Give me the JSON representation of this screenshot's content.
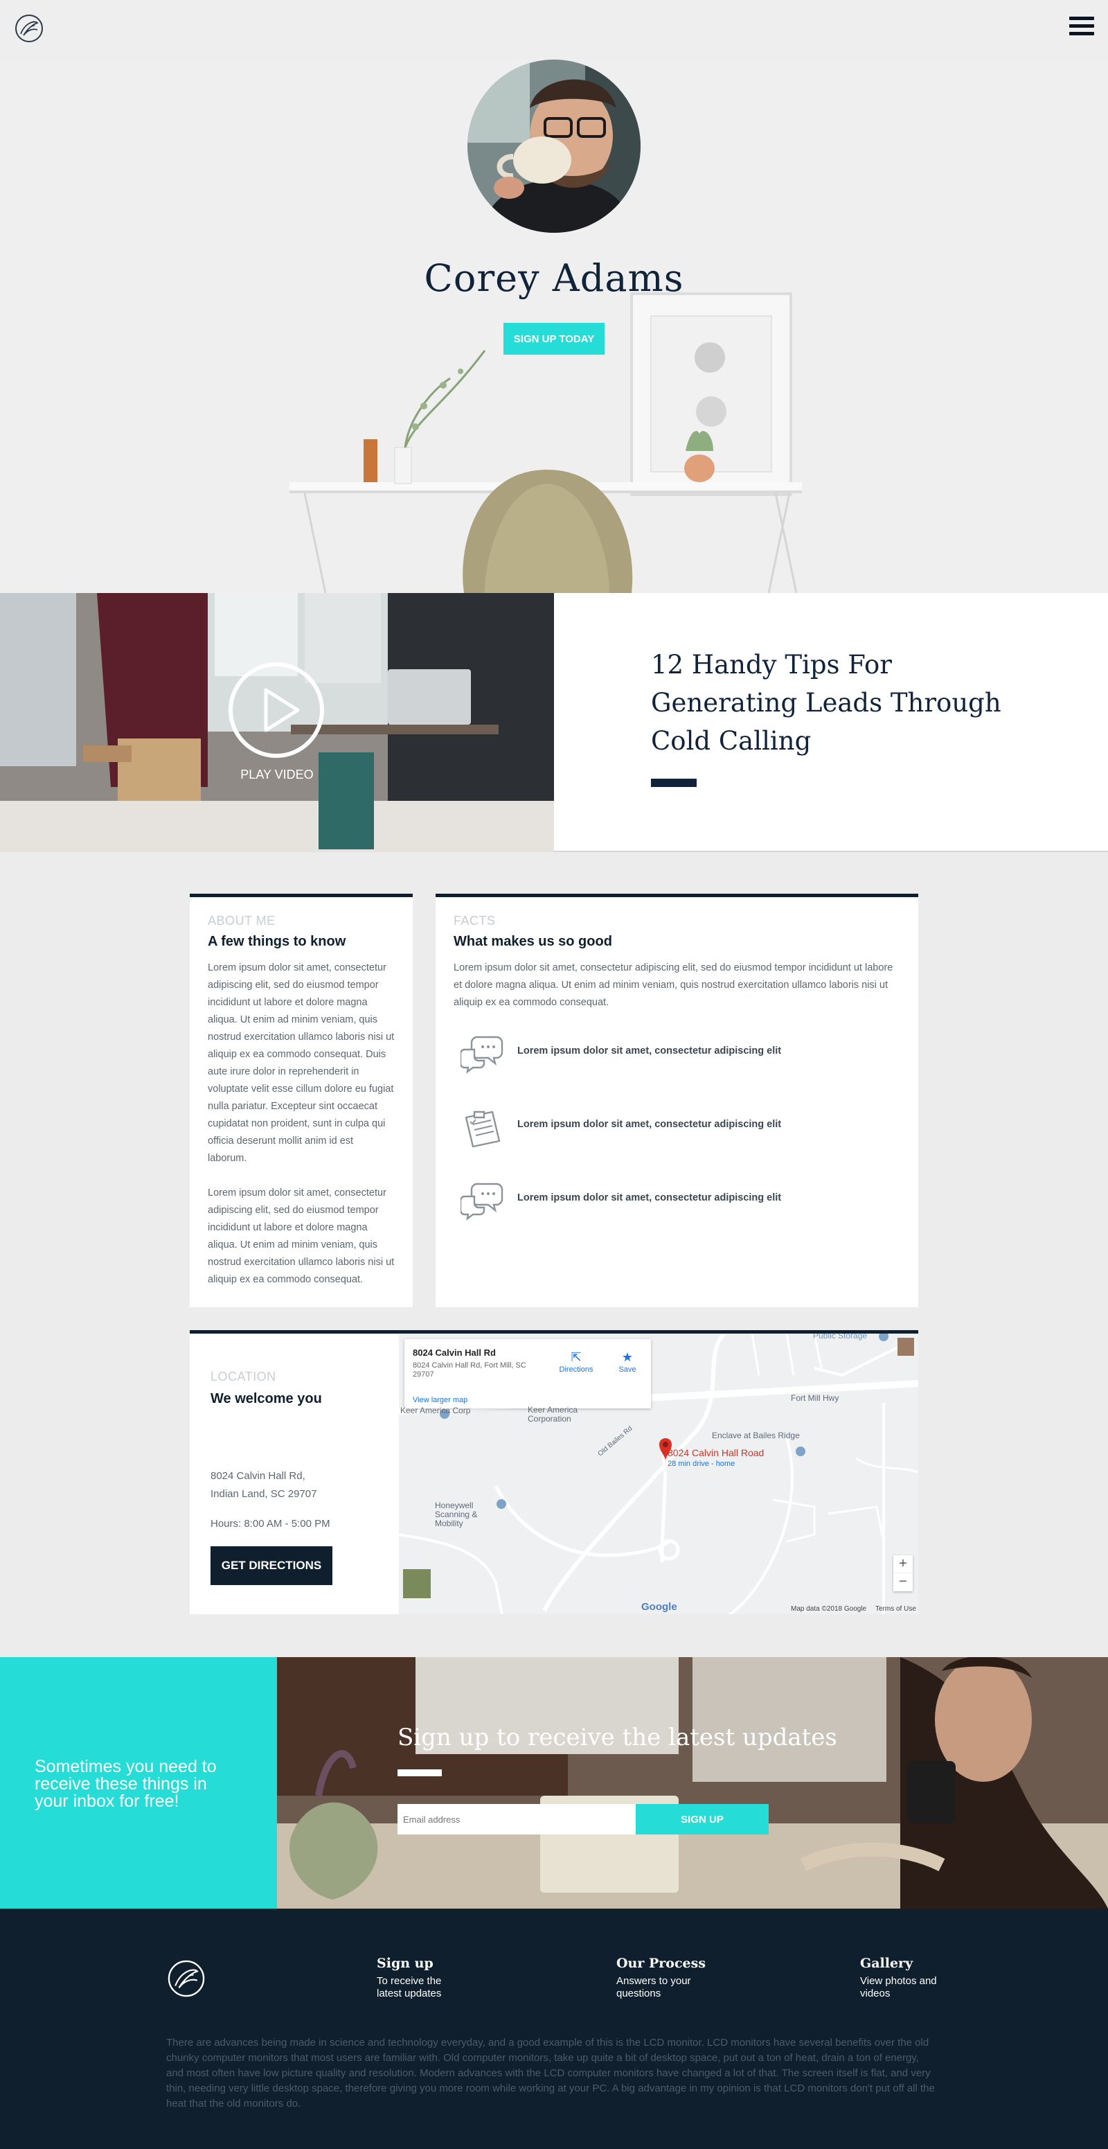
{
  "header": {
    "logo_icon": "leaf-circle-logo",
    "menu_icon": "hamburger-menu-icon"
  },
  "hero": {
    "name": "Corey Adams",
    "cta_label": "SIGN UP TODAY"
  },
  "video": {
    "play_label": "PLAY VIDEO"
  },
  "article": {
    "title": "12 Handy Tips For Generating Leads Through Cold Calling"
  },
  "about": {
    "eyebrow": "ABOUT ME",
    "heading": "A few things to know",
    "paragraph_1": "Lorem ipsum dolor sit amet, consectetur adipiscing elit, sed do eiusmod tempor incididunt ut labore et dolore magna aliqua. Ut enim ad minim veniam, quis nostrud exercitation ullamco laboris nisi ut aliquip ex ea commodo consequat. Duis aute irure dolor in reprehenderit in voluptate velit esse cillum dolore eu fugiat nulla pariatur. Excepteur sint occaecat cupidatat non proident, sunt in culpa qui officia deserunt mollit anim id est laborum.",
    "paragraph_2": "Lorem ipsum dolor sit amet, consectetur adipiscing elit, sed do eiusmod tempor incididunt ut labore et dolore magna aliqua. Ut enim ad minim veniam, quis nostrud exercitation ullamco laboris nisi ut aliquip ex ea commodo consequat."
  },
  "facts": {
    "eyebrow": "FACTS",
    "heading": "What makes us so good",
    "intro": "Lorem ipsum dolor sit amet, consectetur adipiscing elit, sed do eiusmod tempor incididunt ut labore et dolore magna aliqua. Ut enim ad minim veniam, quis nostrud exercitation ullamco laboris nisi ut aliquip ex ea commodo consequat.",
    "items": [
      {
        "icon": "chat-bubbles-icon",
        "text": "Lorem ipsum dolor sit amet, consectetur adipiscing elit"
      },
      {
        "icon": "clipboard-icon",
        "text": "Lorem ipsum dolor sit amet, consectetur adipiscing elit"
      },
      {
        "icon": "chat-bubbles-icon",
        "text": "Lorem ipsum dolor sit amet, consectetur adipiscing elit"
      }
    ]
  },
  "location": {
    "eyebrow": "LOCATION",
    "heading": "We welcome you",
    "address_line_1": "8024 Calvin Hall Rd,",
    "address_line_2": "Indian Land, SC 29707",
    "hours": "Hours: 8:00 AM - 5:00 PM",
    "button_label": "GET DIRECTIONS"
  },
  "map": {
    "card_title": "8024 Calvin Hall Rd",
    "card_address": "8024 Calvin Hall Rd, Fort Mill, SC 29707",
    "directions_label": "Directions",
    "save_label": "Save",
    "larger_map_label": "View larger map",
    "pin_label": "8024 Calvin Hall Road",
    "pin_sublabel": "28 min drive - home",
    "place_1": "Keer America Corp",
    "place_2": "Keer America Corporation",
    "place_3": "Enclave at Bailes Ridge",
    "place_4": "Honeywell Scanning & Mobility",
    "road_1": "Fort Mill Hwy",
    "road_2": "Old Bailes Rd",
    "road_3": "Public Storage",
    "zoom_in": "+",
    "zoom_out": "−",
    "brand": "Google",
    "attribution": "Map data ©2018 Google",
    "terms": "Terms of Use"
  },
  "newsletter": {
    "left_text": "Sometimes you need to receive these things in your inbox for free!",
    "title": "Sign up to receive the latest updates",
    "email_placeholder": "Email address",
    "button_label": "SIGN UP"
  },
  "footer": {
    "columns": [
      {
        "title": "Sign up",
        "subtitle": "To receive the latest updates"
      },
      {
        "title": "Our Process",
        "subtitle": "Answers to your questions"
      },
      {
        "title": "Gallery",
        "subtitle": "View photos and videos"
      }
    ],
    "paragraph": "There are advances being made in science and technology everyday, and a good example of this is the LCD monitor. LCD monitors have several benefits over the old chunky computer monitors that most users are familiar with. Old computer monitors, take up quite a bit of desktop space, put out a ton of heat, drain a ton of energy, and most often have low picture quality and resolution. Modern advances with the LCD computer monitors have changed a lot of that. The screen itself is flat, and very thin, needing very little desktop space, therefore giving you more room while working at your PC. A big advantage in my opinion is that LCD monitors don't put off all the heat that the old monitors do."
  },
  "colors": {
    "accent": "#26dcd6",
    "navy": "#0f1f2e",
    "background": "#ececec"
  }
}
